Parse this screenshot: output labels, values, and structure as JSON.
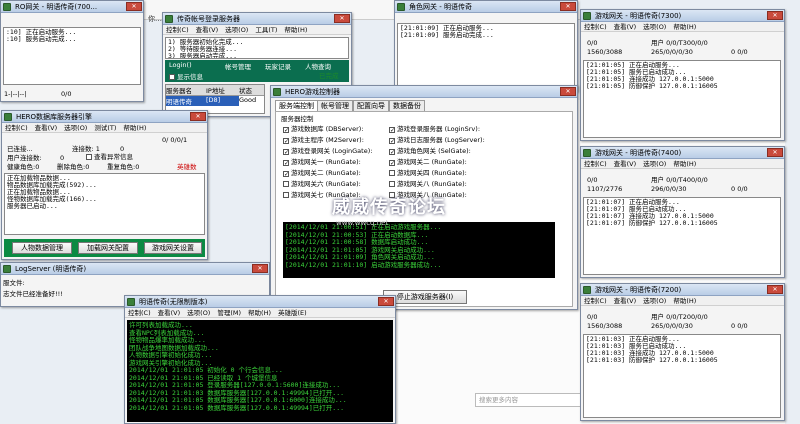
{
  "w_topleft": {
    "title": "RO网关 - 明语传奇(700...",
    "log": ":10] 正在启动服务...\n:10] 服务启动完成...",
    "status_a": "1-|--|--|",
    "status_b": "0/0"
  },
  "w_login": {
    "title": "传奇帐号登录服务器",
    "menu": [
      "控制(C)",
      "查看(V)",
      "选项(O)",
      "工具(T)",
      "帮助(H)"
    ],
    "log": "1) 服务器初始化完成...\n2) 等待服务器连接...\n3) 服务器启动完成...",
    "toolbar": [
      "Login()",
      "帐号管理",
      "玩家记录",
      "人物查询"
    ],
    "checkbox": "显示信息",
    "status": "已完成",
    "table_headers": [
      "服务器名",
      "IP地址",
      "状态"
    ],
    "table_row": [
      "明语传奇",
      "[D8]",
      "Good"
    ]
  },
  "browser_tab": "你…",
  "w_role": {
    "title": "角色网关 - 明语传奇",
    "log": "[21:01:09] 正在启动服务...\n[21:01:09] 服务启动完成..."
  },
  "w_gw7300": {
    "title": "游戏网关 - 明语传奇(7300)",
    "menu": [
      "控制(C)",
      "查看(V)",
      "选项(O)",
      "帮助(H)"
    ],
    "s1a": "0/0",
    "s1b": "用户 0/0/T300/0/0",
    "s2a": "1560/3088",
    "s2b": "265/0/0/0/30",
    "s2c": "0 0/0",
    "log": "[21:01:05] 正在启动服务...\n[21:01:05] 服务已启动成功...\n[21:01:05] 连接成功 127.0.0.1:5000\n[21:01:05] 防御保护 127.0.0.1:16005"
  },
  "w_db": {
    "title": "HERO数据库服务器引擎",
    "menu": [
      "控制(C)",
      "查看(V)",
      "选项(O)",
      "测试(T)",
      "帮助(H)"
    ],
    "counter": "0/ 0/0/1",
    "l1": "已连接...",
    "l1b": "连接数: 1",
    "l1c": "0",
    "l2": "用户连接数:",
    "l2b": "0",
    "l2c": "查看异常信息",
    "l3": "健康角色:0",
    "l3b": "删除角色:0",
    "l3c": "重复角色:0",
    "l3d": "英雄数",
    "log": "正在加载物品数据...\n物品数据库加载完成(592)...\n正在加载物品数据...\n怪物数据库加载完成(166)...\n服务器已启动...",
    "btn1": "人物数据管理",
    "btn2": "加载网关配置",
    "btn3": "游戏网关设置"
  },
  "w_logsrv": {
    "title": "LogServer (明语传奇)",
    "line1": "服文件:",
    "line2": "志文件已经准备好!!!"
  },
  "w_hero": {
    "title": "HERO游戏控制器",
    "tabs": [
      "服务端控制",
      "帐号管理",
      "配置向导",
      "数据备份"
    ],
    "group": "服务器控制",
    "left": [
      "游戏数据库 (DBServer):",
      "游戏主程序 (M2Server):",
      "游戏登录网关 (LoginGate):",
      "游戏网关一 (RunGate):",
      "游戏网关二 (RunGate):",
      "游戏网关六 (RunGate):",
      "游戏网关七 (RunGate):"
    ],
    "right": [
      "游戏登录服务器 (LoginSrv):",
      "游戏日志服务器 (LogServer):",
      "游戏角色网关 (SelGate):",
      "游戏网关二 (RunGate):",
      "游戏网关四 (RunGate):",
      "游戏网关八 (RunGate):",
      "游戏网关八 (RunGate):"
    ],
    "term": "[2014/12/01 21:00:51] 正在启动游戏服务器...\n[2014/12/01 21:00:53] 正在启动数据库...\n[2014/12/01 21:00:58] 数据库启动成功...\n[2014/12/01 21:01:05] 游戏网关启动成功...\n[2014/12/01 21:01:09] 角色网关启动成功...\n[2014/12/01 21:01:10] 启动游戏服务器成功...",
    "btn": "停止游戏服务器(I)"
  },
  "watermark": "威威传奇论坛",
  "watermark_url": "www.wwcq.net",
  "w_mingyu": {
    "title": "明语传奇(无限制版本)",
    "menu": [
      "控制(C)",
      "查看(V)",
      "选项(O)",
      "管理(M)",
      "帮助(H)",
      "英雄版(E)"
    ],
    "term": "许可列表加载成功...\n查看NPC列表加载成功...\n怪物物品爆率加载成功...\n团队战争地图数据加载成功...\n人物数据引擎初始化成功...\n游戏网关引擎初始化成功...\n2014/12/01 21:01:05 初始化 0 个行会信息...\n2014/12/01 21:01:05 已经读取 1 个城堡信息\n2014/12/01 21:01:05 登录服务器[127.0.0.1:5600]连接成功...\n2014/12/01 21:01:03 数据库服务器[127.0.0.1:49994]已打开...\n2014/12/01 21:01:05 数据库服务器[127.0.0.1:6000]连接成功...\n2014/12/01 21:01:05 数据库服务器[127.0.0.1:49994]已打开..."
  },
  "w_gw7400": {
    "title": "游戏网关 - 明语传奇(7400)",
    "menu": [
      "控制(C)",
      "查看(V)",
      "选项(O)",
      "帮助(H)"
    ],
    "s1a": "0/0",
    "s1b": "用户 0/0/T400/0/0",
    "s2a": "1107/2776",
    "s2b": "296/0/0/30",
    "s2c": "0 0/0",
    "log": "[21:01:07] 正在启动服务...\n[21:01:07] 服务已启动成功...\n[21:01:07] 连接成功 127.0.0.1:5000\n[21:01:07] 防御保护 127.0.0.1:16005"
  },
  "w_gw7200": {
    "title": "游戏网关 - 明语传奇(7200)",
    "menu": [
      "控制(C)",
      "查看(V)",
      "选项(O)",
      "帮助(H)"
    ],
    "s1a": "0/0",
    "s1b": "用户 0/0/T200/0/0",
    "s2a": "1560/3088",
    "s2b": "265/0/0/0/30",
    "s2c": "0 0/0",
    "log": "[21:01:03] 正在启动服务...\n[21:01:03] 服务已启动成功...\n[21:01:03] 连接成功 127.0.0.1:5000\n[21:01:03] 防御保护 127.0.0.1:16005"
  },
  "search_placeholder": "搜索更多内容"
}
